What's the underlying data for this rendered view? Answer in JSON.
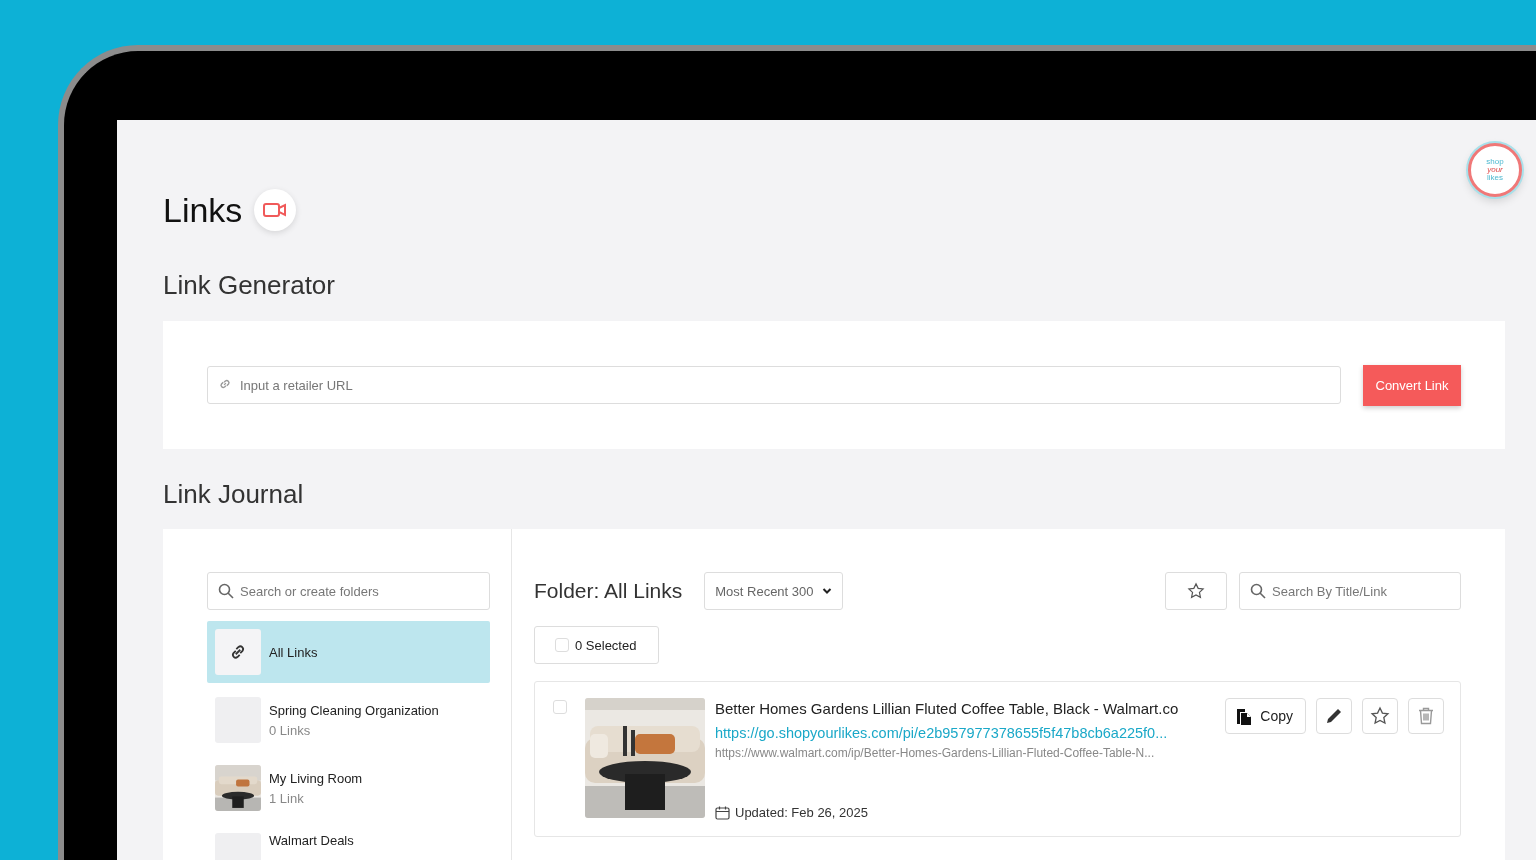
{
  "page": {
    "title": "Links"
  },
  "logo": {
    "lines": [
      "shop",
      "your",
      "likes"
    ]
  },
  "link_generator": {
    "heading": "Link Generator",
    "input": {
      "placeholder": "Input a retailer URL"
    },
    "button": "Convert Link"
  },
  "link_journal": {
    "heading": "Link Journal",
    "folder_search": {
      "placeholder": "Search or create folders"
    },
    "folders": [
      {
        "name": "All Links",
        "kind": "all",
        "selected": true
      },
      {
        "name": "Spring Cleaning Organization",
        "count": "0 Links",
        "kind": "empty",
        "selected": false
      },
      {
        "name": "My Living Room",
        "count": "1 Link",
        "kind": "picture",
        "selected": false
      },
      {
        "name": "Walmart Deals",
        "kind": "empty",
        "selected": false
      }
    ],
    "folder_title": "Folder: All Links",
    "sort": {
      "value": "Most Recent 300"
    },
    "search": {
      "placeholder": "Search By Title/Link"
    },
    "selection": {
      "label": "0 Selected",
      "checked": false
    },
    "links": [
      {
        "checked": false,
        "title": "Better Homes Gardens Lillian Fluted Coffee Table, Black - Walmart.co",
        "short_url": "https://go.shopyourlikes.com/pi/e2b957977378655f5f47b8cb6a225f0...",
        "source_url": "https://www.walmart.com/ip/Better-Homes-Gardens-Lillian-Fluted-Coffee-Table-N...",
        "updated": "Updated: Feb 26, 2025",
        "copy_label": "Copy"
      }
    ]
  }
}
